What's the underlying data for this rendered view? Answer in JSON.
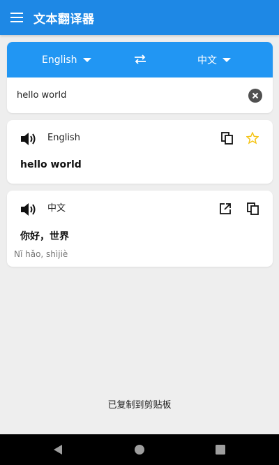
{
  "app": {
    "title": "文本翻译器"
  },
  "language_bar": {
    "source_language": "English",
    "target_language": "中文"
  },
  "input": {
    "value": "hello world"
  },
  "source_result": {
    "language": "English",
    "text": "hello world",
    "favorited": false
  },
  "target_result": {
    "language": "中文",
    "text": "你好，世界",
    "romanization": "Nǐ hǎo, shìjiè"
  },
  "toast": {
    "message": "已复制到剪贴板"
  },
  "colors": {
    "app_bar": "#1E88E5",
    "language_bar": "#2196F3",
    "star": "#F5C518",
    "background": "#EEEEEE"
  }
}
